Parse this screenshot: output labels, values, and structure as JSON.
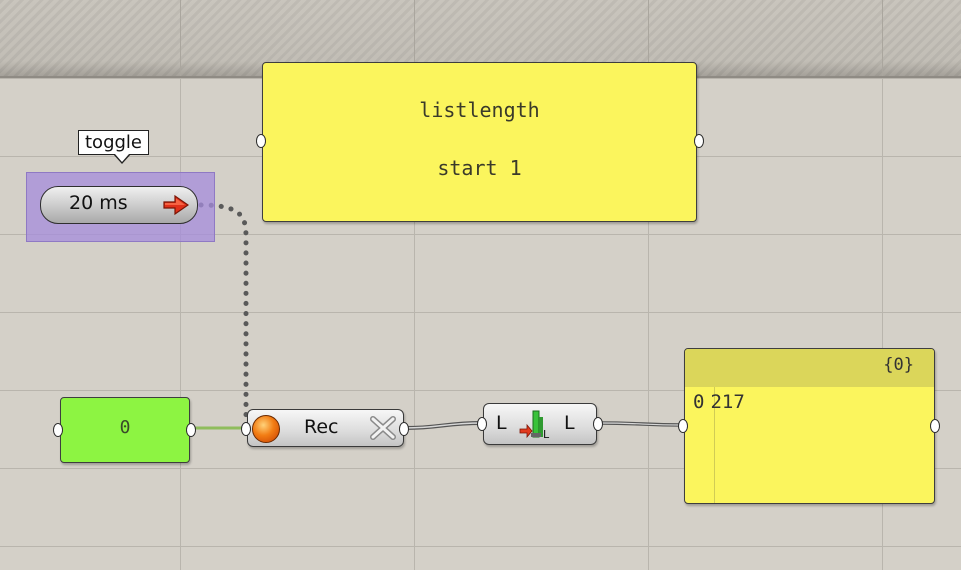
{
  "canvas": {
    "background": "#d4d0c8",
    "grid_color": "#b9b5ad"
  },
  "scribble": {
    "line1": "listlength",
    "line2": "start 1",
    "color": "#fbf55d"
  },
  "timer": {
    "tooltip": "toggle",
    "label": "20 ms",
    "group_color": "#a68cdc"
  },
  "number_panel": {
    "value": "0",
    "color": "#8df442"
  },
  "record_component": {
    "label": "Rec",
    "start_icon": "record-icon",
    "clear_icon": "clear-x-icon"
  },
  "list_length_component": {
    "input_label": "L",
    "output_label": "L",
    "icon": "list-length-icon"
  },
  "output_panel": {
    "path": "{0}",
    "rows": [
      {
        "index": "0",
        "value": "217"
      }
    ],
    "color": "#fbf55d"
  }
}
